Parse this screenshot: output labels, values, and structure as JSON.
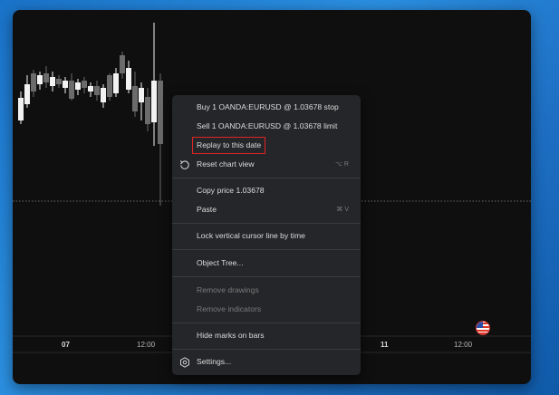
{
  "chart": {
    "time_ticks": [
      {
        "label": "07",
        "bold": true
      },
      {
        "label": "12:00",
        "bold": false
      },
      {
        "label": "11",
        "bold": true
      },
      {
        "label": "12:00",
        "bold": false
      }
    ]
  },
  "context_menu": {
    "items": [
      {
        "label": "Buy 1 OANDA:EURUSD @ 1.03678 stop",
        "shortcut": "",
        "disabled": false
      },
      {
        "label": "Sell 1 OANDA:EURUSD @ 1.03678 limit",
        "shortcut": "",
        "disabled": false
      },
      {
        "label": "Replay to this date",
        "shortcut": "",
        "disabled": false,
        "highlighted": true
      },
      {
        "label": "Reset chart view",
        "shortcut": "⌥ R",
        "icon": "reset-icon",
        "disabled": false
      },
      {
        "label": "Copy price 1.03678",
        "shortcut": "",
        "disabled": false
      },
      {
        "label": "Paste",
        "shortcut": "⌘ V",
        "disabled": false
      },
      {
        "label": "Lock vertical cursor line by time",
        "shortcut": "",
        "disabled": false
      },
      {
        "label": "Object Tree...",
        "shortcut": "",
        "disabled": false
      },
      {
        "label": "Remove drawings",
        "shortcut": "",
        "disabled": true
      },
      {
        "label": "Remove indicators",
        "shortcut": "",
        "disabled": true
      },
      {
        "label": "Hide marks on bars",
        "shortcut": "",
        "disabled": false
      },
      {
        "label": "Settings...",
        "shortcut": "",
        "icon": "gear-icon",
        "disabled": false
      }
    ]
  },
  "colors": {
    "highlight_outline": "#e02424",
    "menu_background": "#252629",
    "chart_background": "#0f0f0f"
  }
}
